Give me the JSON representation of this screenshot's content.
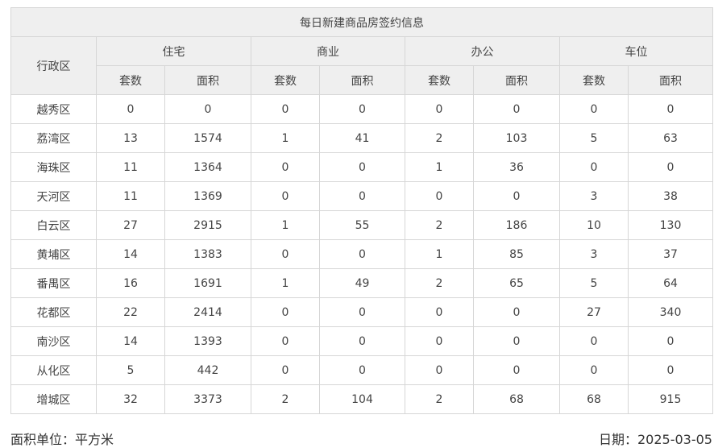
{
  "title": "每日新建商品房签约信息",
  "header": {
    "district": "行政区",
    "groups": [
      "住宅",
      "商业",
      "办公",
      "车位"
    ],
    "sub": [
      "套数",
      "面积"
    ]
  },
  "rows": [
    {
      "district": "越秀区",
      "values": [
        "0",
        "0",
        "0",
        "0",
        "0",
        "0",
        "0",
        "0"
      ]
    },
    {
      "district": "荔湾区",
      "values": [
        "13",
        "1574",
        "1",
        "41",
        "2",
        "103",
        "5",
        "63"
      ]
    },
    {
      "district": "海珠区",
      "values": [
        "11",
        "1364",
        "0",
        "0",
        "1",
        "36",
        "0",
        "0"
      ]
    },
    {
      "district": "天河区",
      "values": [
        "11",
        "1369",
        "0",
        "0",
        "0",
        "0",
        "3",
        "38"
      ]
    },
    {
      "district": "白云区",
      "values": [
        "27",
        "2915",
        "1",
        "55",
        "2",
        "186",
        "10",
        "130"
      ]
    },
    {
      "district": "黄埔区",
      "values": [
        "14",
        "1383",
        "0",
        "0",
        "1",
        "85",
        "3",
        "37"
      ]
    },
    {
      "district": "番禺区",
      "values": [
        "16",
        "1691",
        "1",
        "49",
        "2",
        "65",
        "5",
        "64"
      ]
    },
    {
      "district": "花都区",
      "values": [
        "22",
        "2414",
        "0",
        "0",
        "0",
        "0",
        "27",
        "340"
      ]
    },
    {
      "district": "南沙区",
      "values": [
        "14",
        "1393",
        "0",
        "0",
        "0",
        "0",
        "0",
        "0"
      ]
    },
    {
      "district": "从化区",
      "values": [
        "5",
        "442",
        "0",
        "0",
        "0",
        "0",
        "0",
        "0"
      ]
    },
    {
      "district": "增城区",
      "values": [
        "32",
        "3373",
        "2",
        "104",
        "2",
        "68",
        "68",
        "915"
      ]
    }
  ],
  "footer": {
    "unit": "面积单位：平方米",
    "date": "日期：2025-03-05"
  }
}
